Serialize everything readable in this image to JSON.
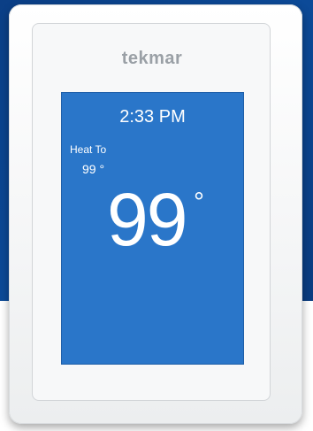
{
  "device": {
    "brand": "tekmar"
  },
  "screen": {
    "time": "2:33 PM",
    "heat_to_label": "Heat To",
    "heat_to_value": "99 °",
    "current_temp": "99",
    "degree_symbol": "°"
  },
  "colors": {
    "screen_bg": "#2a76c9",
    "backdrop_blue": "#0c4a98",
    "bezel_white": "#f7f8f9",
    "logo_gray": "#9aa0a6"
  }
}
